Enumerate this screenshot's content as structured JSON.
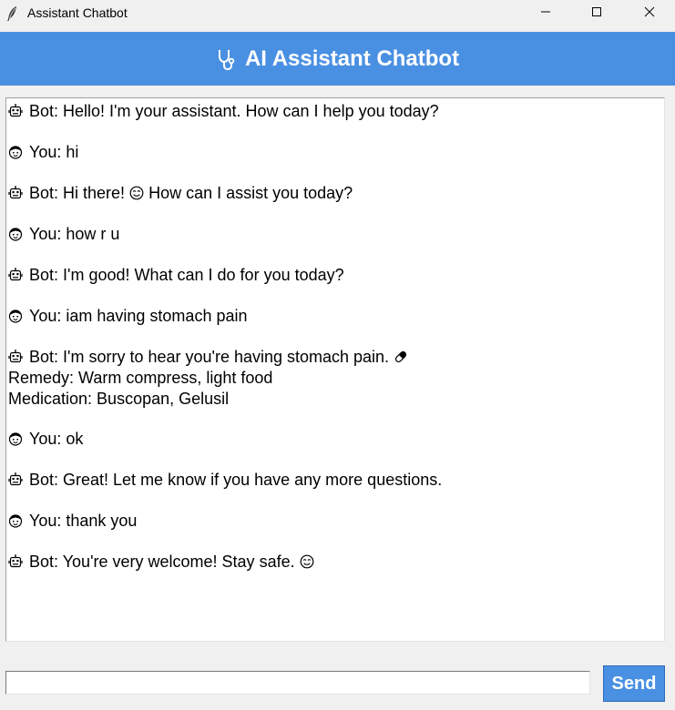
{
  "window": {
    "title": "Assistant Chatbot",
    "app_icon": "feather-icon",
    "controls": [
      "minimize-icon",
      "maximize-icon",
      "close-icon"
    ]
  },
  "header": {
    "icon": "stethoscope-icon",
    "title": "AI Assistant Chatbot",
    "background": "#4a90e2",
    "text_color": "#ffffff"
  },
  "messages": [
    {
      "sender": "bot",
      "icon": "robot-icon",
      "text": "Bot: Hello! I'm your assistant. How can I help you today?"
    },
    {
      "sender": "user",
      "icon": "user-face-icon",
      "text": "You: hi"
    },
    {
      "sender": "bot",
      "icon": "robot-icon",
      "text": "Bot: Hi there! ",
      "suffix_icon": "smiley-icon",
      "text_after": " How can I assist you today?"
    },
    {
      "sender": "user",
      "icon": "user-face-icon",
      "text": "You: how r u"
    },
    {
      "sender": "bot",
      "icon": "robot-icon",
      "text": "Bot: I'm good! What can I do for you today?"
    },
    {
      "sender": "user",
      "icon": "user-face-icon",
      "text": "You: iam having stomach pain"
    },
    {
      "sender": "bot",
      "icon": "robot-icon",
      "text": "Bot: I'm sorry to hear you're having stomach pain. ",
      "suffix_icon": "pill-icon",
      "extra_lines": [
        "Remedy: Warm compress, light food",
        "Medication: Buscopan, Gelusil"
      ]
    },
    {
      "sender": "user",
      "icon": "user-face-icon",
      "text": "You: ok"
    },
    {
      "sender": "bot",
      "icon": "robot-icon",
      "text": "Bot: Great! Let me know if you have any more questions."
    },
    {
      "sender": "user",
      "icon": "user-face-icon",
      "text": "You: thank you"
    },
    {
      "sender": "bot",
      "icon": "robot-icon",
      "text": "Bot: You're very welcome! Stay safe. ",
      "suffix_icon": "smiley-icon"
    }
  ],
  "input": {
    "value": "",
    "placeholder": ""
  },
  "send_button": {
    "label": "Send",
    "background": "#4a90e2"
  }
}
